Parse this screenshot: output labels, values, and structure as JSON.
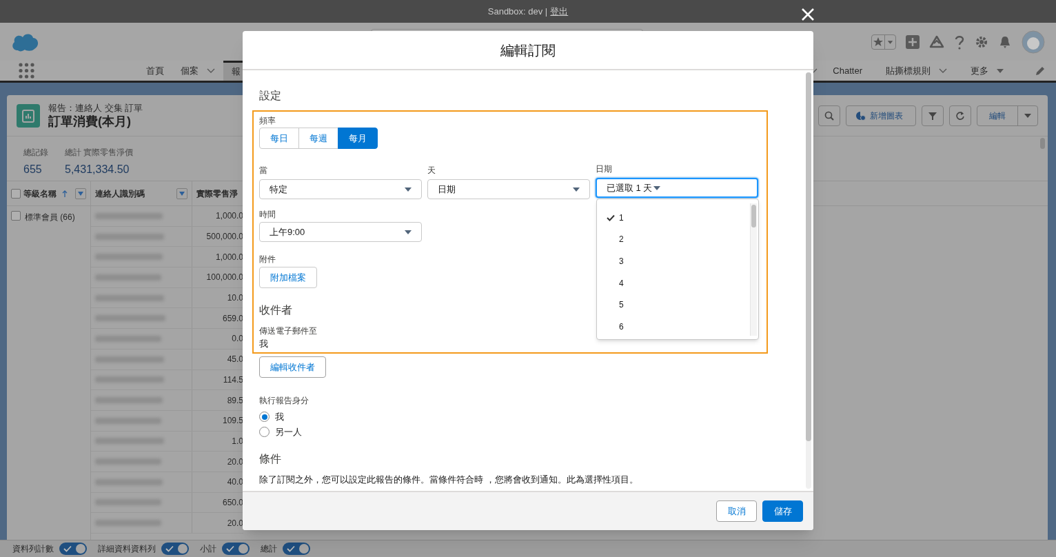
{
  "system_bar": {
    "text": "Sandbox: dev |",
    "link": "登出"
  },
  "nav": {
    "left": [
      {
        "label": "首頁",
        "menu": false,
        "selected": false
      },
      {
        "label": "個案",
        "menu": true,
        "selected": false
      },
      {
        "label": "報",
        "menu": false,
        "selected": true
      }
    ],
    "right": [
      {
        "label": "Chatter",
        "kind": "plain"
      },
      {
        "label": "貼撕標規則",
        "kind": "chevron"
      },
      {
        "label": "更多",
        "kind": "caret"
      }
    ]
  },
  "report": {
    "breadcrumb": "報告：連絡人 交集 訂單",
    "title": "訂單消費(本月)",
    "add_chart": "新增圖表",
    "edit": "編輯",
    "stats": [
      {
        "label": "總記錄",
        "value": "655"
      },
      {
        "label": "總計 實際零售淨價",
        "value": "5,431,334.50"
      }
    ],
    "all_checked": false,
    "columns": [
      {
        "label": "等級名稱",
        "sorted": true,
        "menu": true
      },
      {
        "label": "連絡人識別碼",
        "sorted": false,
        "menu": true
      },
      {
        "label": "實際零售淨"
      }
    ],
    "group": {
      "label": "標準會員 (66)",
      "checked": false
    },
    "rows": [
      "1,000.0",
      "500,000.0",
      "1,000.0",
      "100,000.0",
      "10.0",
      "659.0",
      "0.0",
      "45.0",
      "114.5",
      "89.5",
      "109.5",
      "1.0",
      "20.0",
      "40.0",
      "650.0",
      "20.0"
    ],
    "toggles": [
      {
        "label": "資料列計數",
        "on": true
      },
      {
        "label": "詳細資料資料列",
        "on": true
      },
      {
        "label": "小計",
        "on": true
      },
      {
        "label": "總計",
        "on": true
      }
    ]
  },
  "modal": {
    "title": "編輯訂閱",
    "settings_heading": "設定",
    "frequency": {
      "label": "頻率",
      "options": [
        {
          "label": "每日",
          "selected": false
        },
        {
          "label": "每週",
          "selected": false
        },
        {
          "label": "每月",
          "selected": true
        }
      ]
    },
    "selects": [
      {
        "label": "當",
        "value": "特定",
        "focused": false
      },
      {
        "label": "天",
        "value": "日期",
        "focused": false
      },
      {
        "label": "日期",
        "value": "已選取 1 天",
        "focused": true
      }
    ],
    "time": {
      "label": "時間",
      "value": "上午9:00"
    },
    "attachment": {
      "label": "附件",
      "button": "附加檔案"
    },
    "recipients_heading": "收件者",
    "send_to_label": "傳送電子郵件至",
    "send_to_value": "我",
    "edit_recipients": "編輯收件者",
    "run_as": {
      "label": "執行報告身分",
      "options": [
        {
          "label": "我",
          "selected": true
        },
        {
          "label": "另一人",
          "selected": false
        }
      ]
    },
    "conditions_heading": "條件",
    "conditions_text": "除了訂閱之外，您可以設定此報告的條件。當條件符合時 ，您將會收到通知。此為選擇性項目。",
    "day_options": [
      {
        "label": "1",
        "selected": true
      },
      {
        "label": "2",
        "selected": false
      },
      {
        "label": "3",
        "selected": false
      },
      {
        "label": "4",
        "selected": false
      },
      {
        "label": "5",
        "selected": false
      },
      {
        "label": "6",
        "selected": false
      }
    ],
    "buttons": [
      {
        "label": "取消",
        "kind": "neutral"
      },
      {
        "label": "儲存",
        "kind": "brand"
      }
    ]
  }
}
